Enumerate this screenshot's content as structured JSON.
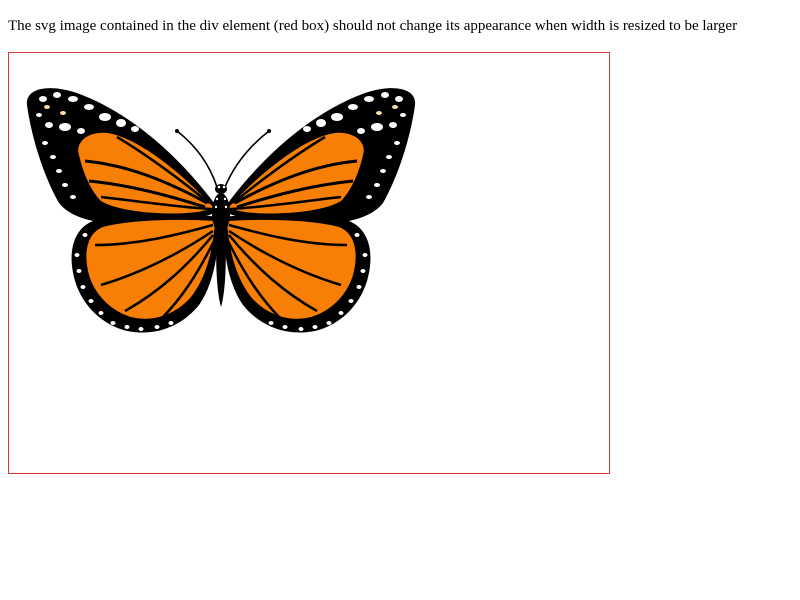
{
  "caption": "The svg image contained in the div element (red box) should not change its appearance when width is resized to be larger",
  "box_color": "#d9383b",
  "image": {
    "subject": "monarch-butterfly",
    "colors": {
      "wing_orange": "#f77f05",
      "outline": "#000000",
      "spots": "#ffffff",
      "spot_tint": "#fcd9a8"
    }
  }
}
